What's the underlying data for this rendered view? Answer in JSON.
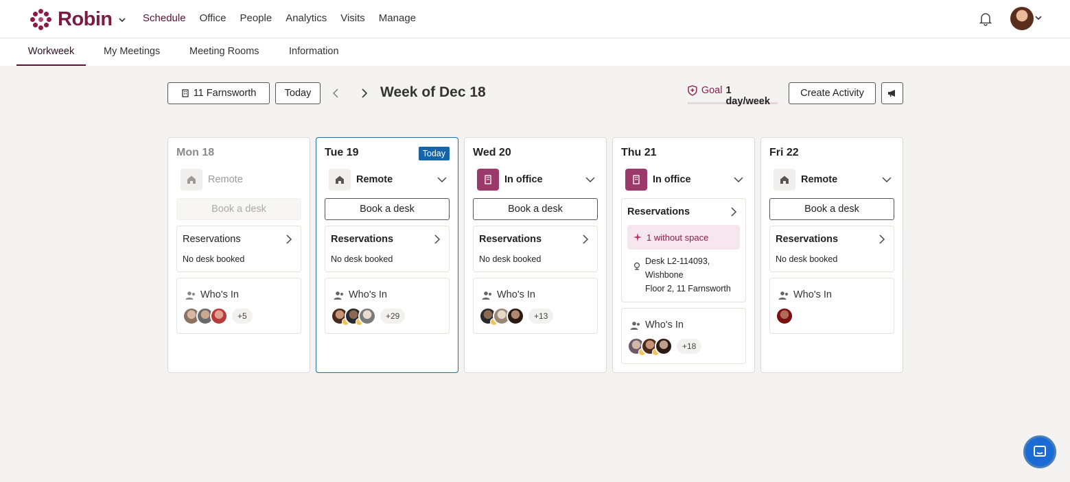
{
  "app": {
    "name": "Robin"
  },
  "nav": {
    "items": [
      "Schedule",
      "Office",
      "People",
      "Analytics",
      "Visits",
      "Manage"
    ],
    "active": "Schedule"
  },
  "subnav": {
    "tabs": [
      "Workweek",
      "My Meetings",
      "Meeting Rooms",
      "Information"
    ],
    "active": "Workweek"
  },
  "toolbar": {
    "location": "11 Farnsworth",
    "today": "Today",
    "week_title": "Week of Dec 18",
    "goal_label": "Goal",
    "goal_value": "1 day/week",
    "create_activity": "Create Activity"
  },
  "days": [
    {
      "title": "Mon 18",
      "status": "Remote",
      "book": "Book a desk",
      "res_title": "Reservations",
      "res_sub": "No desk booked",
      "who_title": "Who's In",
      "more": "+5"
    },
    {
      "title": "Tue 19",
      "badge": "Today",
      "status": "Remote",
      "book": "Book a desk",
      "res_title": "Reservations",
      "res_sub": "No desk booked",
      "who_title": "Who's In",
      "more": "+29"
    },
    {
      "title": "Wed 20",
      "status": "In office",
      "book": "Book a desk",
      "res_title": "Reservations",
      "res_sub": "No desk booked",
      "who_title": "Who's In",
      "more": "+13"
    },
    {
      "title": "Thu 21",
      "status": "In office",
      "res_title": "Reservations",
      "pill": "1 without space",
      "desk_line1": "Desk L2-114093,",
      "desk_line2": "Wishbone",
      "desk_line3": "Floor 2, 11 Farnsworth",
      "who_title": "Who's In",
      "more": "+18"
    },
    {
      "title": "Fri 22",
      "status": "Remote",
      "book": "Book a desk",
      "res_title": "Reservations",
      "res_sub": "No desk booked",
      "who_title": "Who's In"
    }
  ],
  "colors": {
    "brand": "#7a1a45",
    "today_badge": "#1565a8",
    "office_icon": "#9b3a6a"
  }
}
